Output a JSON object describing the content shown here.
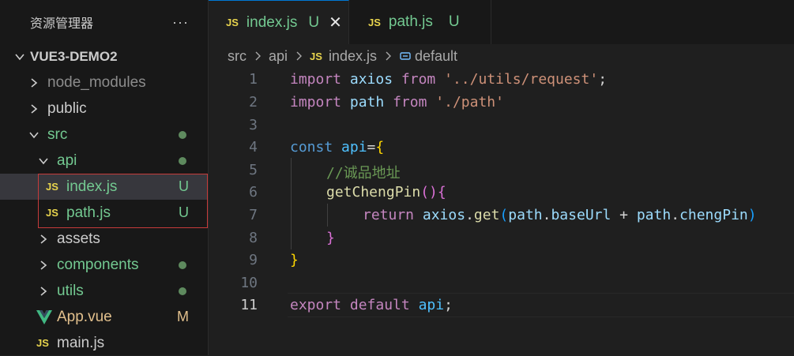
{
  "explorer": {
    "title": "资源管理器",
    "more": "···",
    "root": "VUE3-DEMO2",
    "items": [
      {
        "label": "node_modules"
      },
      {
        "label": "public"
      },
      {
        "label": "src"
      },
      {
        "label": "api"
      },
      {
        "label": "index.js",
        "icon": "JS",
        "badge": "U"
      },
      {
        "label": "path.js",
        "icon": "JS",
        "badge": "U"
      },
      {
        "label": "assets"
      },
      {
        "label": "components"
      },
      {
        "label": "utils"
      },
      {
        "label": "App.vue",
        "badge": "M"
      },
      {
        "label": "main.js",
        "icon": "JS"
      }
    ]
  },
  "tabs": [
    {
      "icon": "JS",
      "label": "index.js",
      "status": "U",
      "close": "✕"
    },
    {
      "icon": "JS",
      "label": "path.js",
      "status": "U"
    }
  ],
  "breadcrumb": [
    "src",
    "api",
    "index.js",
    "default"
  ],
  "breadcrumb_js": "JS",
  "editor": {
    "line_numbers": [
      "1",
      "2",
      "3",
      "4",
      "5",
      "6",
      "7",
      "8",
      "9",
      "10",
      "11"
    ],
    "lines": {
      "l1": {
        "a": "import",
        "b": "axios",
        "c": "from",
        "d": "'../utils/request'",
        "e": ";"
      },
      "l2": {
        "a": "import",
        "b": "path",
        "c": "from",
        "d": "'./path'"
      },
      "l4": {
        "a": "const",
        "b": "api",
        "c": "=",
        "d": "{"
      },
      "l5": {
        "a": "//诚品地址"
      },
      "l6": {
        "a": "getChengPin",
        "b": "()",
        "c": "{"
      },
      "l7": {
        "a": "return",
        "b": "axios",
        "c": ".",
        "d": "get",
        "e": "(",
        "f": "path",
        "g": ".",
        "h": "baseUrl",
        "i": " + ",
        "j": "path",
        "k": ".",
        "l": "chengPin",
        "m": ")"
      },
      "l8": {
        "a": "}"
      },
      "l9": {
        "a": "}"
      },
      "l11": {
        "a": "export",
        "b": "default",
        "c": "api",
        "d": ";"
      }
    }
  },
  "colors": {
    "accent": "#0078d4",
    "untracked": "#73c991",
    "modified": "#e2c08d"
  }
}
